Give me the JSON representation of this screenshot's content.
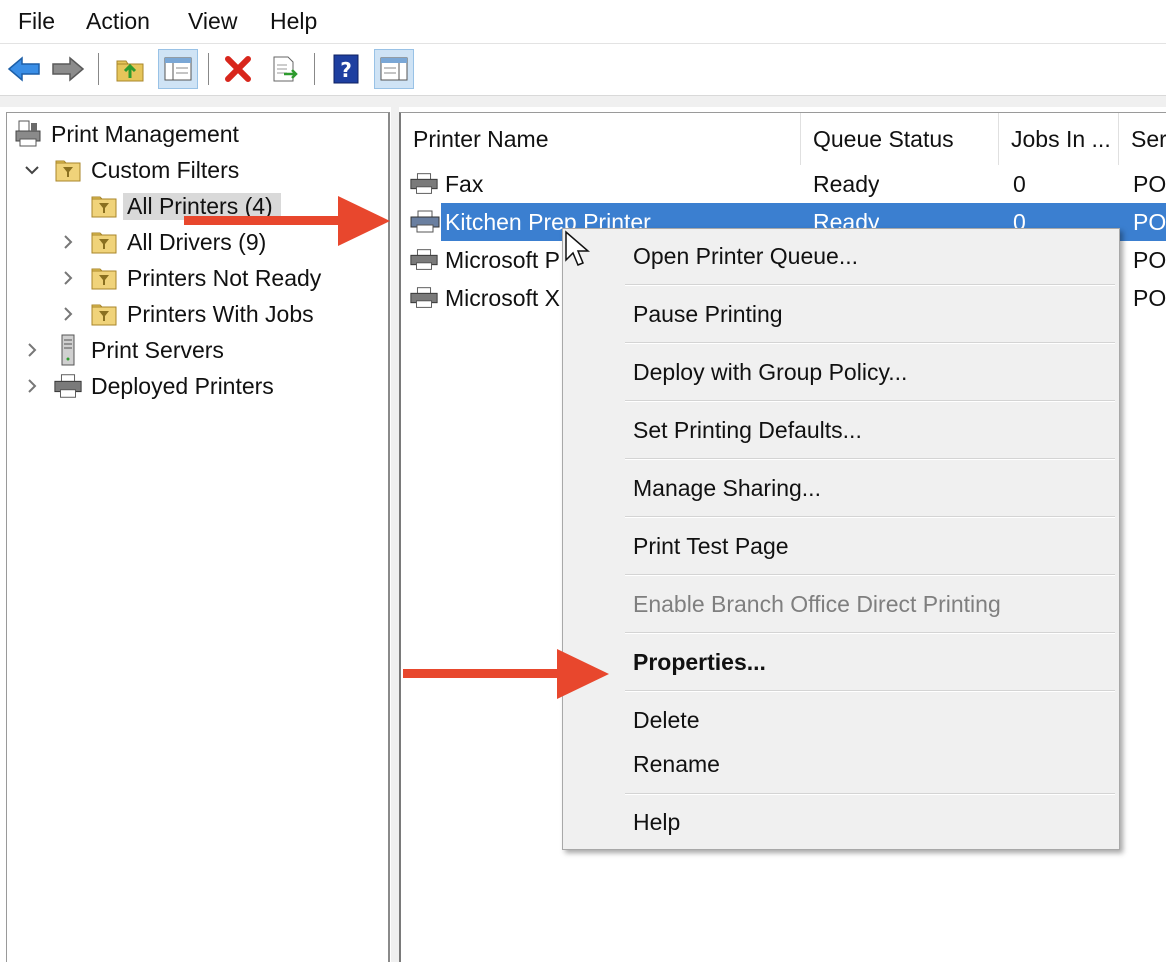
{
  "menubar": {
    "items": [
      "File",
      "Action",
      "View",
      "Help"
    ]
  },
  "toolbar": {
    "buttons": [
      "back-arrow-icon",
      "forward-arrow-icon",
      "up-folder-icon",
      "show-hide-console-tree-icon",
      "delete-icon",
      "export-list-icon",
      "help-icon",
      "show-action-pane-icon"
    ]
  },
  "tree": {
    "root": "Print Management",
    "custom_filters": "Custom Filters",
    "all_printers": "All Printers (4)",
    "all_drivers": "All Drivers (9)",
    "printers_not_ready": "Printers Not Ready",
    "printers_with_jobs": "Printers With Jobs",
    "print_servers": "Print Servers",
    "deployed_printers": "Deployed Printers"
  },
  "list": {
    "columns": [
      "Printer Name",
      "Queue Status",
      "Jobs In ...",
      "Ser"
    ],
    "rows": [
      {
        "name": "Fax",
        "status": "Ready",
        "jobs": "0",
        "server": "POS"
      },
      {
        "name": "Kitchen Prep Printer",
        "status": "Ready",
        "jobs": "0",
        "server": "POS"
      },
      {
        "name": "Microsoft P",
        "status": "",
        "jobs": "",
        "server": "POS"
      },
      {
        "name": "Microsoft X",
        "status": "",
        "jobs": "",
        "server": "POS"
      }
    ]
  },
  "context_menu": {
    "open_queue": "Open Printer Queue...",
    "pause": "Pause Printing",
    "deploy": "Deploy with Group Policy...",
    "set_defaults": "Set Printing Defaults...",
    "manage_sharing": "Manage Sharing...",
    "test_page": "Print Test Page",
    "branch_office": "Enable Branch Office Direct Printing",
    "properties": "Properties...",
    "delete": "Delete",
    "rename": "Rename",
    "help": "Help"
  },
  "colors": {
    "selection": "#3b7fd0",
    "annotation_arrow": "#e8472d",
    "menu_bg": "#f0f0f0"
  }
}
